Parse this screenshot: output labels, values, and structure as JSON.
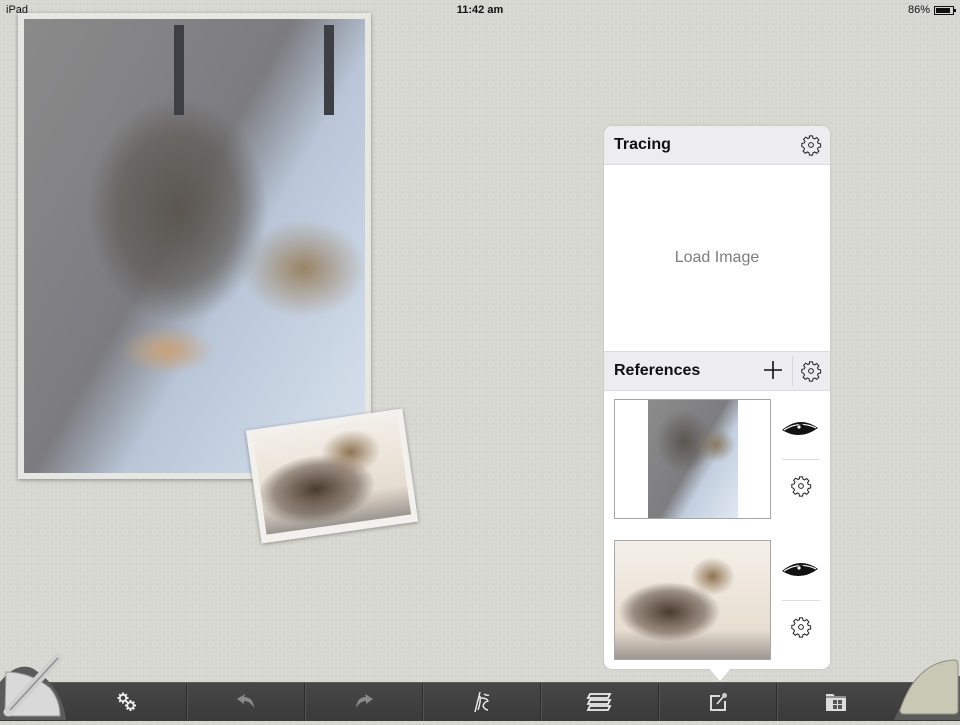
{
  "status_bar": {
    "carrier": "iPad",
    "time": "11:42 am",
    "battery_percent_label": "86%",
    "battery_level": 0.86
  },
  "canvas": {
    "photos": [
      {
        "name": "main-reference-photo",
        "description": "tabby kitten crouching, looking right"
      },
      {
        "name": "small-reference-photo",
        "description": "tabby cat lying, facing camera"
      }
    ]
  },
  "popover": {
    "tracing": {
      "title": "Tracing",
      "settings_icon": "gear-icon",
      "load_label": "Load Image"
    },
    "references": {
      "title": "References",
      "add_icon": "plus-icon",
      "settings_icon": "gear-icon",
      "items": [
        {
          "orientation": "portrait",
          "visible": true,
          "visibility_icon": "eye-icon",
          "settings_icon": "gear-icon"
        },
        {
          "orientation": "landscape",
          "visible": true,
          "visibility_icon": "eye-icon",
          "settings_icon": "gear-icon"
        }
      ]
    }
  },
  "toolbar": {
    "left_corner_icon": "brush-tool-icon",
    "right_corner_icon": "color-swatch-icon",
    "buttons": [
      {
        "name": "settings",
        "icon": "gears-icon"
      },
      {
        "name": "undo",
        "icon": "undo-icon"
      },
      {
        "name": "redo",
        "icon": "redo-icon"
      },
      {
        "name": "brushes",
        "icon": "brush-library-icon"
      },
      {
        "name": "layers",
        "icon": "layers-icon"
      },
      {
        "name": "reference",
        "icon": "reference-edit-icon",
        "active": true
      },
      {
        "name": "gallery",
        "icon": "gallery-folder-icon"
      }
    ]
  }
}
